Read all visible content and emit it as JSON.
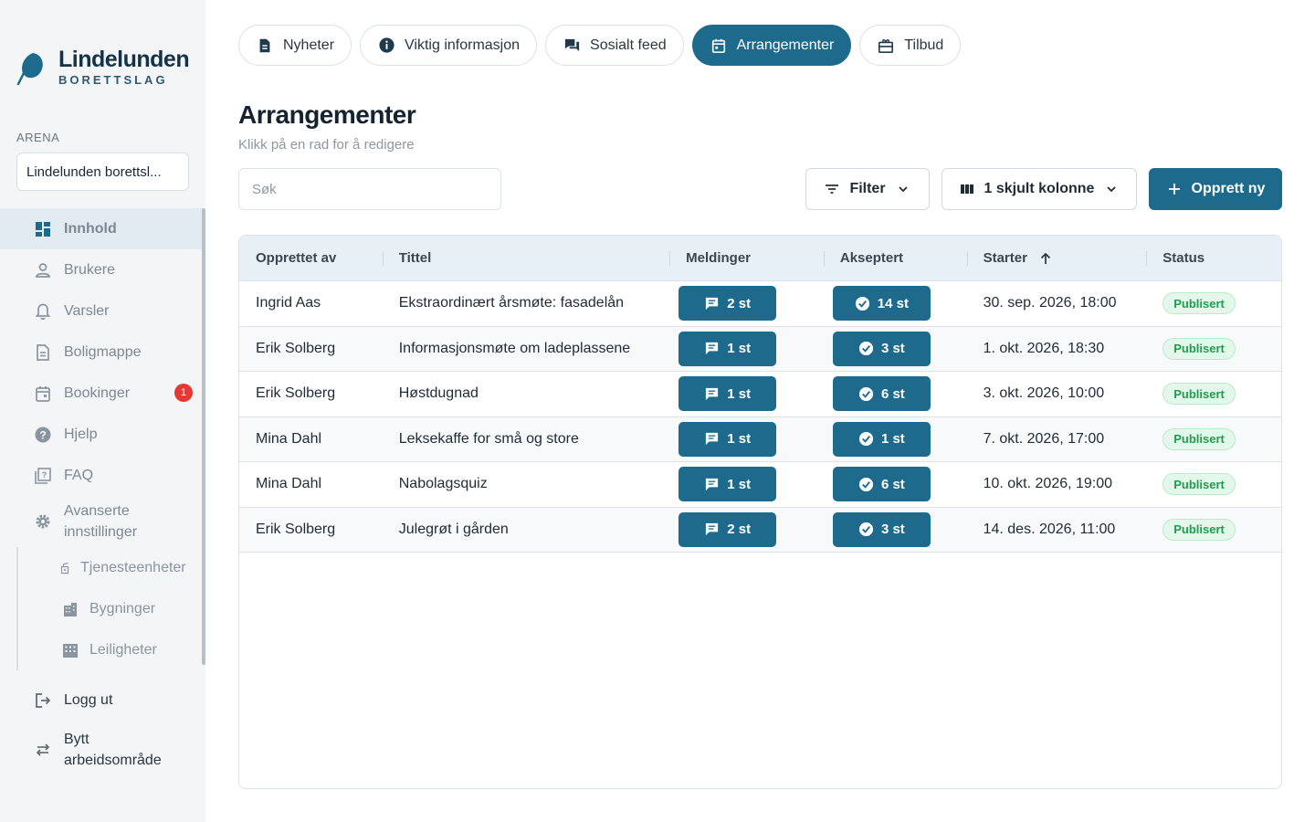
{
  "brand": {
    "name": "Lindelunden",
    "sub": "BORETTSLAG",
    "color": "#1e6a8c"
  },
  "arena": {
    "label": "ARENA",
    "value": "Lindelunden borettsl..."
  },
  "sidebar": {
    "items": [
      {
        "label": "Innhold",
        "icon": "dashboard-icon"
      },
      {
        "label": "Brukere",
        "icon": "user-icon"
      },
      {
        "label": "Varsler",
        "icon": "bell-icon"
      },
      {
        "label": "Boligmappe",
        "icon": "document-icon"
      },
      {
        "label": "Bookinger",
        "icon": "calendar-icon",
        "badge": "1"
      },
      {
        "label": "Hjelp",
        "icon": "help-icon"
      },
      {
        "label": "FAQ",
        "icon": "faq-icon"
      },
      {
        "label": "Avanserte innstillinger",
        "icon": "gear-icon"
      }
    ],
    "sub_items": [
      {
        "label": "Tjenesteenheter",
        "icon": "device-icon"
      },
      {
        "label": "Bygninger",
        "icon": "building-icon"
      },
      {
        "label": "Leiligheter",
        "icon": "apartment-icon"
      }
    ],
    "logout": "Logg ut",
    "switch": "Bytt arbeidsområde"
  },
  "tabs": [
    {
      "label": "Nyheter",
      "icon": "news-icon"
    },
    {
      "label": "Viktig informasjon",
      "icon": "info-icon"
    },
    {
      "label": "Sosialt feed",
      "icon": "chat-icon"
    },
    {
      "label": "Arrangementer",
      "icon": "event-icon",
      "active": true
    },
    {
      "label": "Tilbud",
      "icon": "offer-icon"
    }
  ],
  "page": {
    "title": "Arrangementer",
    "subtitle": "Klikk på en rad for å redigere"
  },
  "search": {
    "placeholder": "Søk",
    "value": ""
  },
  "toolbar": {
    "filter_label": "Filter",
    "columns_label": "1 skjult kolonne",
    "create_label": "Opprett ny"
  },
  "table": {
    "columns": [
      "Opprettet av",
      "Tittel",
      "Meldinger",
      "Akseptert",
      "Starter",
      "Status"
    ],
    "sort": {
      "column": "Starter",
      "direction": "ascending"
    },
    "rows": [
      {
        "author": "Ingrid Aas",
        "title": "Ekstraordinært årsmøte: fasadelån",
        "messages": "2 st",
        "accepted": "14 st",
        "start": "30. sep. 2026, 18:00",
        "status": "Publisert"
      },
      {
        "author": "Erik Solberg",
        "title": "Informasjonsmøte om ladeplassene",
        "messages": "1 st",
        "accepted": "3 st",
        "start": "1. okt. 2026, 18:30",
        "status": "Publisert"
      },
      {
        "author": "Erik Solberg",
        "title": "Høstdugnad",
        "messages": "1 st",
        "accepted": "6 st",
        "start": "3. okt. 2026, 10:00",
        "status": "Publisert"
      },
      {
        "author": "Mina Dahl",
        "title": "Leksekaffe for små og store",
        "messages": "1 st",
        "accepted": "1 st",
        "start": "7. okt. 2026, 17:00",
        "status": "Publisert"
      },
      {
        "author": "Mina Dahl",
        "title": "Nabolagsquiz",
        "messages": "1 st",
        "accepted": "6 st",
        "start": "10. okt. 2026, 19:00",
        "status": "Publisert"
      },
      {
        "author": "Erik Solberg",
        "title": "Julegrøt i gården",
        "messages": "2 st",
        "accepted": "3 st",
        "start": "14. des. 2026, 11:00",
        "status": "Publisert"
      }
    ]
  }
}
